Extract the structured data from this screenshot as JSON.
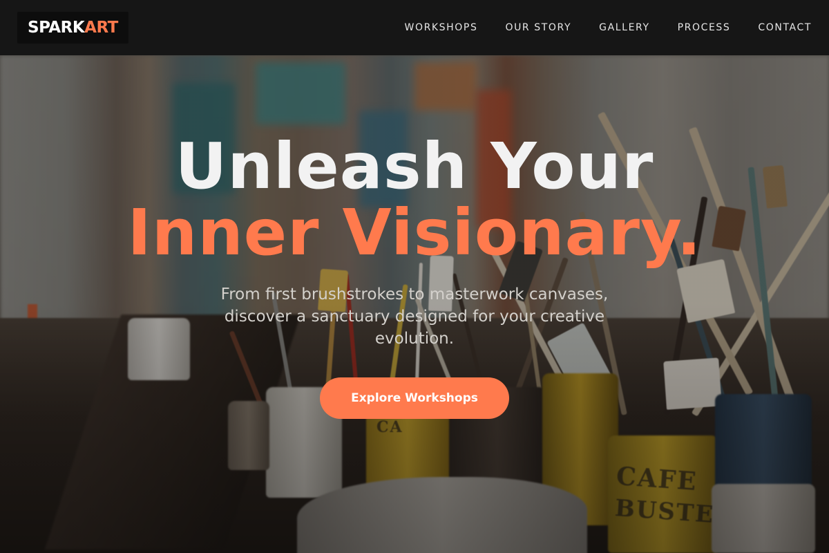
{
  "brand": {
    "logo_part1": "SPARK",
    "logo_part2": "ART",
    "accent_color": "#ff7a4d"
  },
  "nav": {
    "links": [
      {
        "label": "WORKSHOPS"
      },
      {
        "label": "OUR STORY"
      },
      {
        "label": "GALLERY"
      },
      {
        "label": "PROCESS"
      },
      {
        "label": "CONTACT"
      }
    ]
  },
  "hero": {
    "headline_line1": "Unleash Your",
    "headline_line2": "Inner Visionary.",
    "subtitle": "From first brushstrokes to masterwork canvases, discover a sanctuary designed for your creative evolution.",
    "cta_label": "Explore Workshops",
    "background_image": "art studio workbench with jars of paintbrushes and paint cans"
  }
}
